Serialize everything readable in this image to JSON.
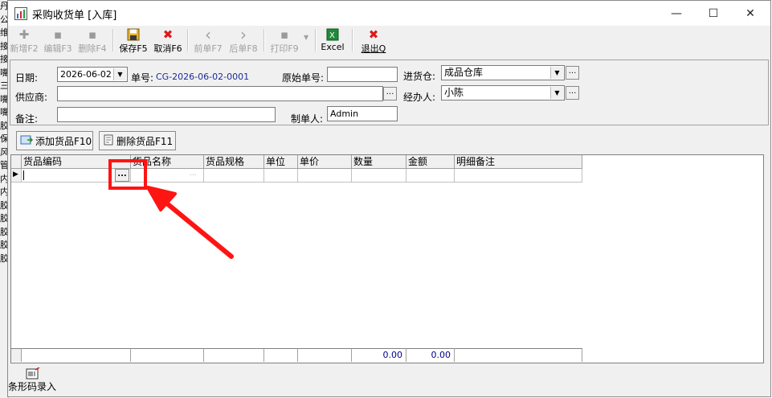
{
  "background_app": {
    "chars": [
      "丹",
      "公",
      "",
      "维",
      "接",
      "接",
      "嘴",
      "三",
      "嘴",
      "嘴",
      "胶",
      "保",
      "风",
      "管",
      "内",
      "内",
      "胶",
      "胶",
      "胶",
      "胶",
      "胶"
    ]
  },
  "window": {
    "title": "采购收货单 [入库]",
    "controls": {
      "minimize": "—",
      "maximize": "☐",
      "close": "✕"
    }
  },
  "toolbar": {
    "items": [
      {
        "label": "新增F2",
        "icon": "✚",
        "enabled": false
      },
      {
        "label": "编辑F3",
        "icon": "▪",
        "enabled": false
      },
      {
        "label": "删除F4",
        "icon": "▪",
        "enabled": false
      },
      {
        "label": "保存F5",
        "icon": "💾",
        "enabled": true
      },
      {
        "label": "取消F6",
        "icon": "✖",
        "enabled": true
      },
      {
        "label": "前单F7",
        "icon": "‹",
        "enabled": false
      },
      {
        "label": "后单F8",
        "icon": "›",
        "enabled": false
      },
      {
        "label": "打印F9",
        "icon": "▪",
        "enabled": false
      },
      {
        "label": "Excel",
        "icon": "X",
        "enabled": true
      },
      {
        "label": "退出Q",
        "icon": "✖",
        "enabled": true
      }
    ],
    "print_dropdown": "▼"
  },
  "form": {
    "date_label": "日期:",
    "date_value": "2026-06-02",
    "order_no_label": "单号:",
    "order_no_value": "CG-2026-06-02-0001",
    "orig_no_label": "原始单号:",
    "orig_no_value": "",
    "warehouse_label": "进货仓:",
    "warehouse_value": "成品仓库",
    "supplier_label": "供应商:",
    "supplier_value": "",
    "handler_label": "经办人:",
    "handler_value": "小陈",
    "remark_label": "备注:",
    "remark_value": "",
    "maker_label": "制单人:",
    "maker_value": "Admin",
    "ellipsis": "...",
    "dropdown_arrow": "▼"
  },
  "actions": {
    "add_goods": "添加货品F10",
    "delete_goods": "删除货品F11"
  },
  "grid": {
    "columns": [
      "货品编码",
      "货品名称",
      "货品规格",
      "单位",
      "单价",
      "数量",
      "金额",
      "明细备注"
    ],
    "row_indicator": "▶",
    "row_ellipsis": "...",
    "row_ellipsis2": "...",
    "footer": {
      "quantity_total": "0.00",
      "amount_total": "0.00"
    }
  },
  "statusbar": {
    "barcode_entry": "条形码录入"
  }
}
